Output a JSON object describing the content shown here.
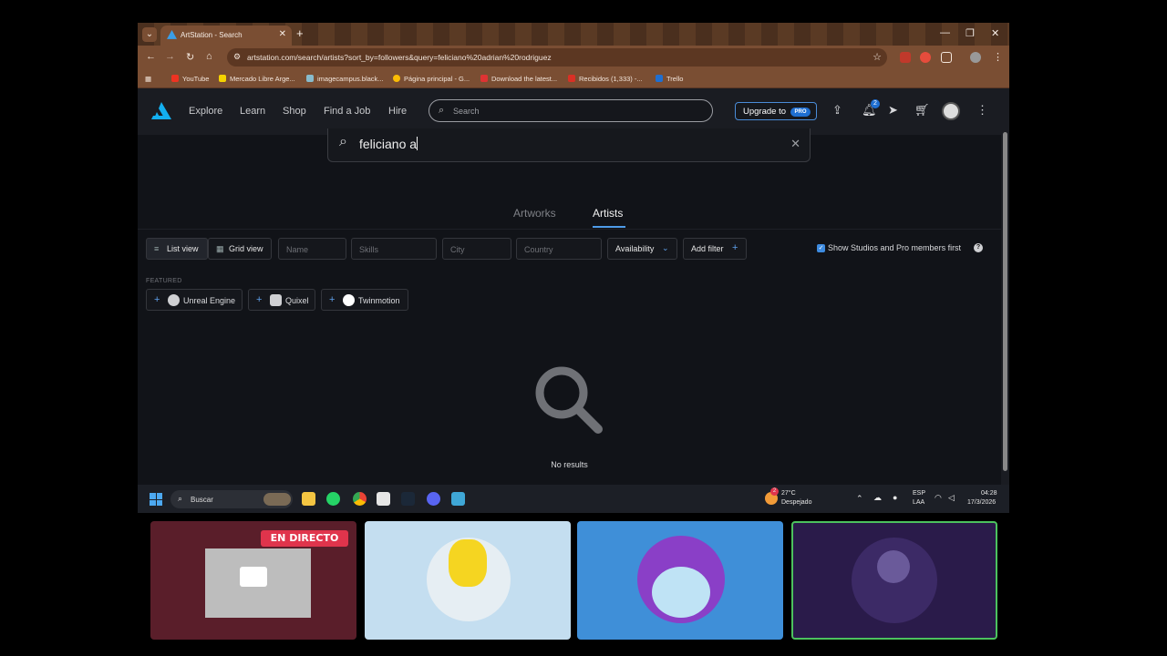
{
  "browser": {
    "tab_title": "ArtStation - Search",
    "url": "artstation.com/search/artists?sort_by=followers&query=feliciano%20adrian%20rodriguez",
    "bookmarks": [
      "YouTube",
      "Mercado Libre Arge...",
      "imagecampus.black...",
      "Página principal - G...",
      "Download the latest...",
      "Recibidos (1,333) -...",
      "Trello"
    ]
  },
  "nav": {
    "links": [
      "Explore",
      "Learn",
      "Shop",
      "Find a Job",
      "Hire"
    ],
    "search_placeholder": "Search",
    "upgrade_label": "Upgrade to",
    "pro_badge": "PRO",
    "notification_count": "2"
  },
  "search": {
    "query": "feliciano a"
  },
  "tabs": {
    "artworks": "Artworks",
    "artists": "Artists"
  },
  "filters": {
    "list_view": "List view",
    "grid_view": "Grid view",
    "name": "Name",
    "skills": "Skills",
    "city": "City",
    "country": "Country",
    "availability": "Availability",
    "add_filter": "Add filter",
    "show_studios": "Show Studios and Pro members first"
  },
  "featured": {
    "label": "FEATURED",
    "items": [
      "Unreal Engine",
      "Quixel",
      "Twinmotion"
    ]
  },
  "results": {
    "empty_text": "No results"
  },
  "taskbar": {
    "search_placeholder": "Buscar",
    "weather_temp": "27°C",
    "weather_desc": "Despejado",
    "weather_badge": "2",
    "lang": "ESP",
    "lang2": "LAA",
    "time": "04:28",
    "date": "17/3/2026"
  },
  "call": {
    "live_badge": "EN DIRECTO"
  },
  "colors": {
    "accent": "#4e9be8",
    "live": "#e0344c",
    "active_speaker": "#4cc25e"
  }
}
